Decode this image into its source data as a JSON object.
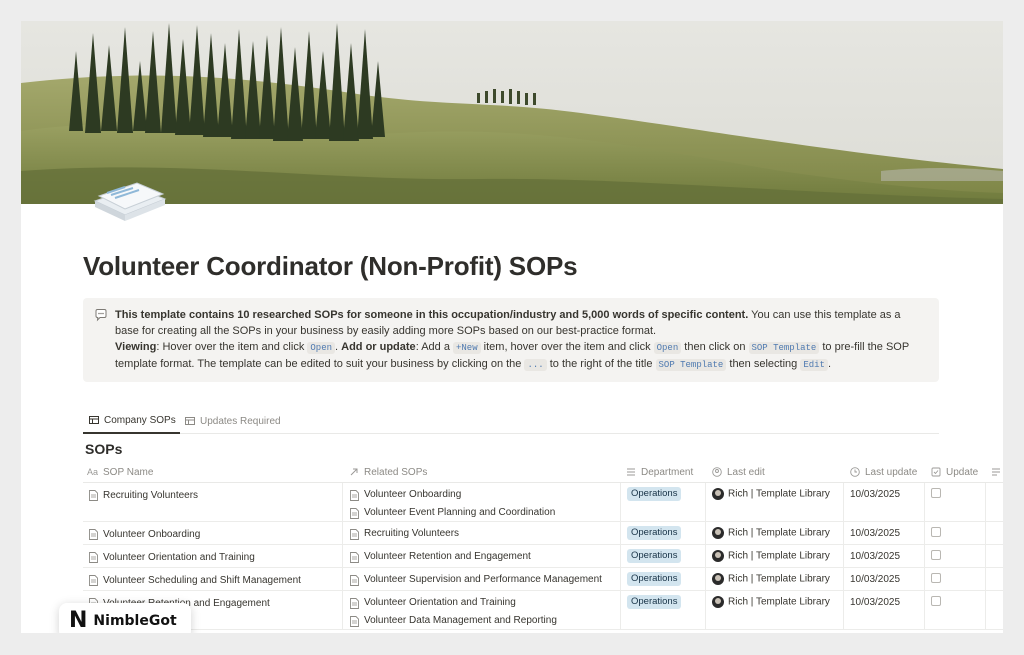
{
  "page": {
    "title": "Volunteer Coordinator (Non-Profit) SOPs",
    "cover_image": "tuscan-hills-cypress-trees",
    "icon": "stacked-documents-icon"
  },
  "callout": {
    "icon": "speech-bubble-icon",
    "intro_bold": "This template contains 10 researched SOPs for someone in this occupation/industry and 5,000 words of specific content.",
    "intro_rest": " You can use this template as a base for creating all the SOPs in your business by easily adding more SOPs based on our best-practice format.",
    "viewing_label": "Viewing",
    "viewing_text_1": ": Hover over the item and click ",
    "code_open": "Open",
    "sep": ". ",
    "add_label": "Add or update",
    "add_text_1": ": Add a ",
    "code_new": "+New",
    "add_text_2": " item, hover over the item and click ",
    "add_text_3": " then click on ",
    "code_template": "SOP Template",
    "add_text_4": " to pre-fill the SOP template format. The template can be edited to suit your business by clicking on the ",
    "code_dots": "...",
    "add_text_5": " to the right of the title ",
    "add_text_6": " then selecting ",
    "code_edit": "Edit",
    "end": "."
  },
  "tabs": [
    {
      "label": "Company SOPs",
      "active": true,
      "icon": "table-icon"
    },
    {
      "label": "Updates Required",
      "active": false,
      "icon": "table-icon"
    }
  ],
  "database": {
    "title": "SOPs",
    "columns": [
      {
        "label": "SOP Name",
        "icon": "text-property-icon"
      },
      {
        "label": "Related SOPs",
        "icon": "relation-arrow-icon"
      },
      {
        "label": "Department",
        "icon": "list-icon"
      },
      {
        "label": "Last edit",
        "icon": "person-icon"
      },
      {
        "label": "Last update",
        "icon": "clock-icon"
      },
      {
        "label": "Update",
        "icon": "checkbox-icon"
      }
    ],
    "rows": [
      {
        "name": "Recruiting Volunteers",
        "related": [
          "Volunteer Onboarding",
          "Volunteer Event Planning and Coordination"
        ],
        "department": "Operations",
        "editor": "Rich | Template Library",
        "date": "10/03/2025",
        "update": false
      },
      {
        "name": "Volunteer Onboarding",
        "related": [
          "Recruiting Volunteers"
        ],
        "department": "Operations",
        "editor": "Rich | Template Library",
        "date": "10/03/2025",
        "update": false
      },
      {
        "name": "Volunteer Orientation and Training",
        "related": [
          "Volunteer Retention and Engagement"
        ],
        "department": "Operations",
        "editor": "Rich | Template Library",
        "date": "10/03/2025",
        "update": false
      },
      {
        "name": "Volunteer Scheduling and Shift Management",
        "related": [
          "Volunteer Supervision and Performance Management"
        ],
        "department": "Operations",
        "editor": "Rich | Template Library",
        "date": "10/03/2025",
        "update": false
      },
      {
        "name": "Volunteer Retention and Engagement",
        "related": [
          "Volunteer Orientation and Training",
          "Volunteer Data Management and Reporting"
        ],
        "department": "Operations",
        "editor": "Rich | Template Library",
        "date": "10/03/2025",
        "update": false
      }
    ]
  },
  "watermark": {
    "letter": "N",
    "text": "NimbleGot"
  },
  "colors": {
    "tag_bg": "#d3e5ef",
    "tag_text": "#183347",
    "callout_bg": "#f4f3f1"
  }
}
